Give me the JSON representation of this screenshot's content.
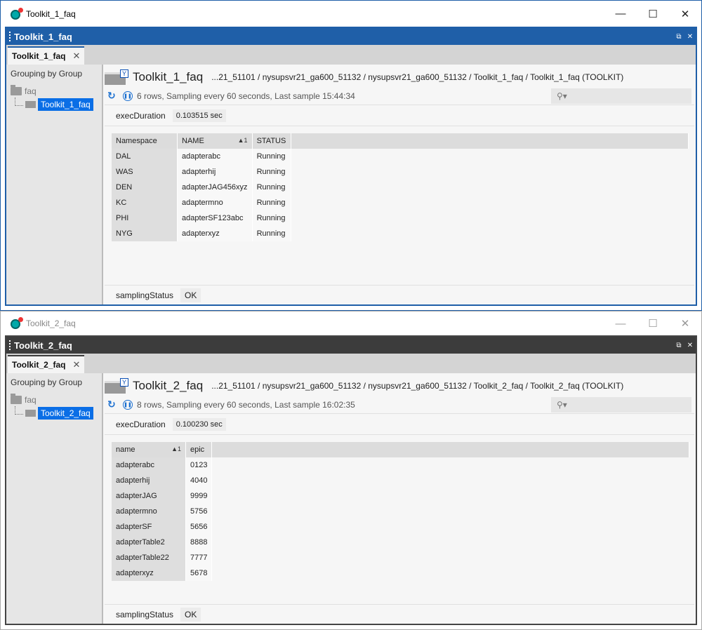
{
  "windows": [
    {
      "os_title": "Toolkit_1_faq",
      "inner_title": "Toolkit_1_faq",
      "tab_label": "Toolkit_1_faq",
      "tree": {
        "group_header": "Grouping by Group",
        "folder": "faq",
        "selected": "Toolkit_1_faq"
      },
      "header_title": "Toolkit_1_faq",
      "path": "...21_51101 / nysupsvr21_ga600_51132 / nysupsvr21_ga600_51132 / Toolkit_1_faq / Toolkit_1_faq (TOOLKIT)",
      "status_text": "6 rows, Sampling every 60 seconds, Last sample 15:44:34",
      "exec_label": "execDuration",
      "exec_value": "0.103515 sec",
      "columns": [
        "Namespace",
        "NAME",
        "STATUS"
      ],
      "rows": [
        [
          "DAL",
          "adapterabc",
          "Running"
        ],
        [
          "WAS",
          "adapterhij",
          "Running"
        ],
        [
          "DEN",
          "adapterJAG456xyz",
          "Running"
        ],
        [
          "KC",
          "adaptermno",
          "Running"
        ],
        [
          "PHI",
          "adapterSF123abc",
          "Running"
        ],
        [
          "NYG",
          "adapterxyz",
          "Running"
        ]
      ],
      "footer_label": "samplingStatus",
      "footer_value": "OK"
    },
    {
      "os_title": "Toolkit_2_faq",
      "inner_title": "Toolkit_2_faq",
      "tab_label": "Toolkit_2_faq",
      "tree": {
        "group_header": "Grouping by Group",
        "folder": "faq",
        "selected": "Toolkit_2_faq"
      },
      "header_title": "Toolkit_2_faq",
      "path": "...21_51101 / nysupsvr21_ga600_51132 / nysupsvr21_ga600_51132 / Toolkit_2_faq / Toolkit_2_faq (TOOLKIT)",
      "status_text": "8 rows, Sampling every 60 seconds, Last sample 16:02:35",
      "exec_label": "execDuration",
      "exec_value": "0.100230 sec",
      "columns": [
        "name",
        "epic"
      ],
      "rows": [
        [
          "adapterabc",
          "0123"
        ],
        [
          "adapterhij",
          "4040"
        ],
        [
          "adapterJAG",
          "9999"
        ],
        [
          "adaptermno",
          "5756"
        ],
        [
          "adapterSF",
          "5656"
        ],
        [
          "adapterTable2",
          "8888"
        ],
        [
          "adapterTable22",
          "7777"
        ],
        [
          "adapterxyz",
          "5678"
        ]
      ],
      "footer_label": "samplingStatus",
      "footer_value": "OK"
    }
  ],
  "icons": {
    "minimize": "—",
    "maximize": "☐",
    "close": "✕",
    "tab_close": "✕",
    "refresh": "↻",
    "pause": "❚❚",
    "search": "⚲▾",
    "filter": "Y",
    "sort": "▲1",
    "restore_small": "⧉",
    "close_small": "✕"
  },
  "colors": {
    "accent": "#1f5fa8",
    "selection": "#0a6ee6",
    "inactive_header": "#3c3c3c"
  }
}
